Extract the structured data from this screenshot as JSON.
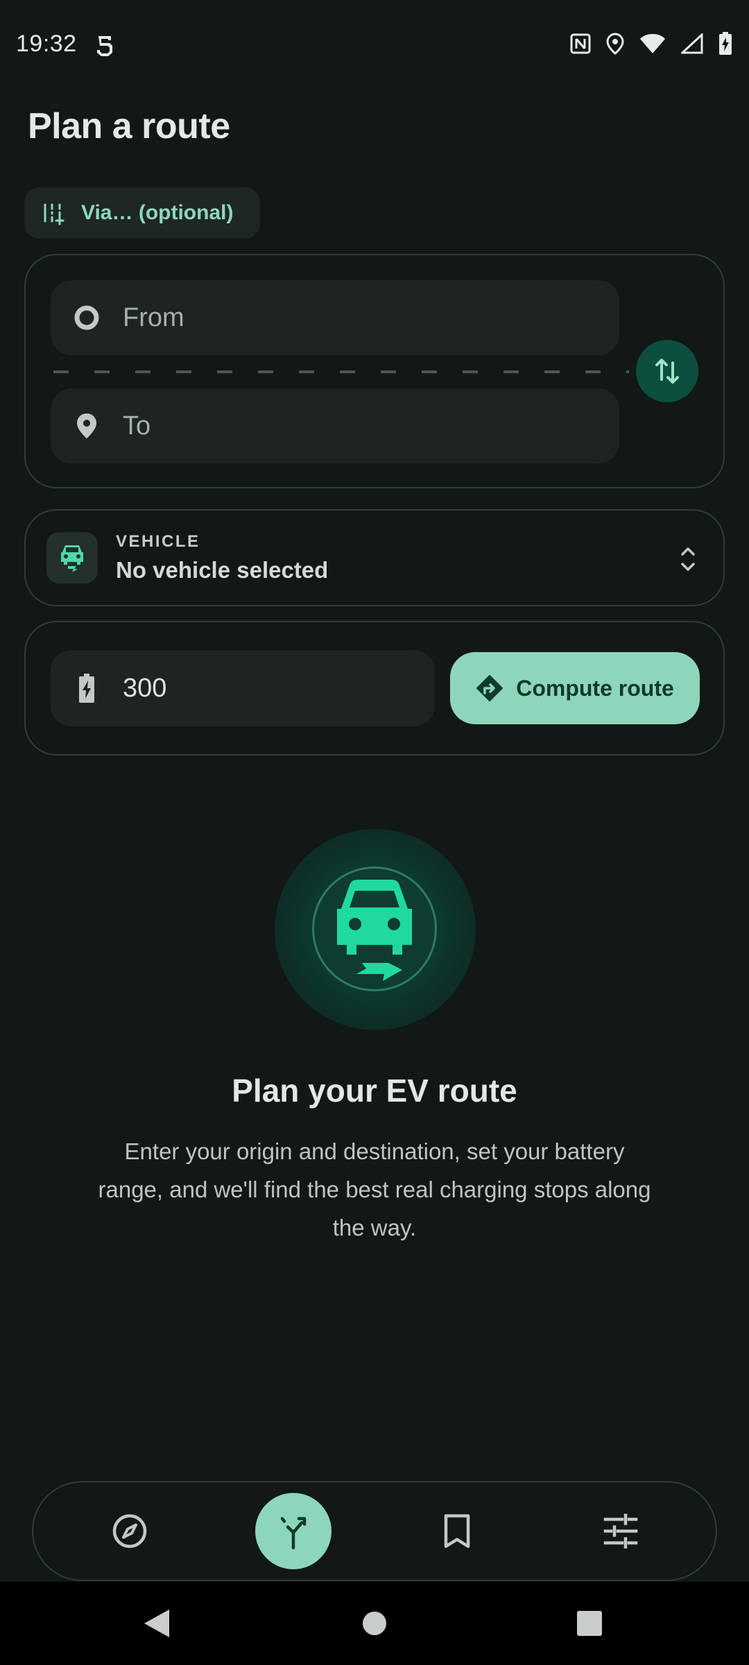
{
  "status_bar": {
    "time": "19:32"
  },
  "page": {
    "title": "Plan a route"
  },
  "via_chip": {
    "label": "Via… (optional)",
    "icon": "add-stop-icon"
  },
  "route": {
    "from_placeholder": "From",
    "to_placeholder": "To",
    "from_icon": "origin-circle-icon",
    "to_icon": "location-pin-icon",
    "swap_icon": "swap-vertical-icon"
  },
  "vehicle": {
    "caption": "VEHICLE",
    "value": "No vehicle selected",
    "icon": "ev-car-icon"
  },
  "range": {
    "value": "300",
    "icon": "battery-charging-icon",
    "compute_label": "Compute route",
    "compute_icon": "directions-icon"
  },
  "hero": {
    "title": "Plan your EV route",
    "body": "Enter your origin and destination, set your battery range, and we'll find the best real charging stops along the way."
  },
  "bottom_nav": {
    "items": [
      {
        "icon": "compass-icon",
        "active": false
      },
      {
        "icon": "route-fork-icon",
        "active": true
      },
      {
        "icon": "bookmark-icon",
        "active": false
      },
      {
        "icon": "tune-icon",
        "active": false
      }
    ]
  },
  "colors": {
    "background": "#111816",
    "accent": "#8ed6bb",
    "accent_dark": "#0c4f3e",
    "icon_green": "#1fd9a0"
  }
}
